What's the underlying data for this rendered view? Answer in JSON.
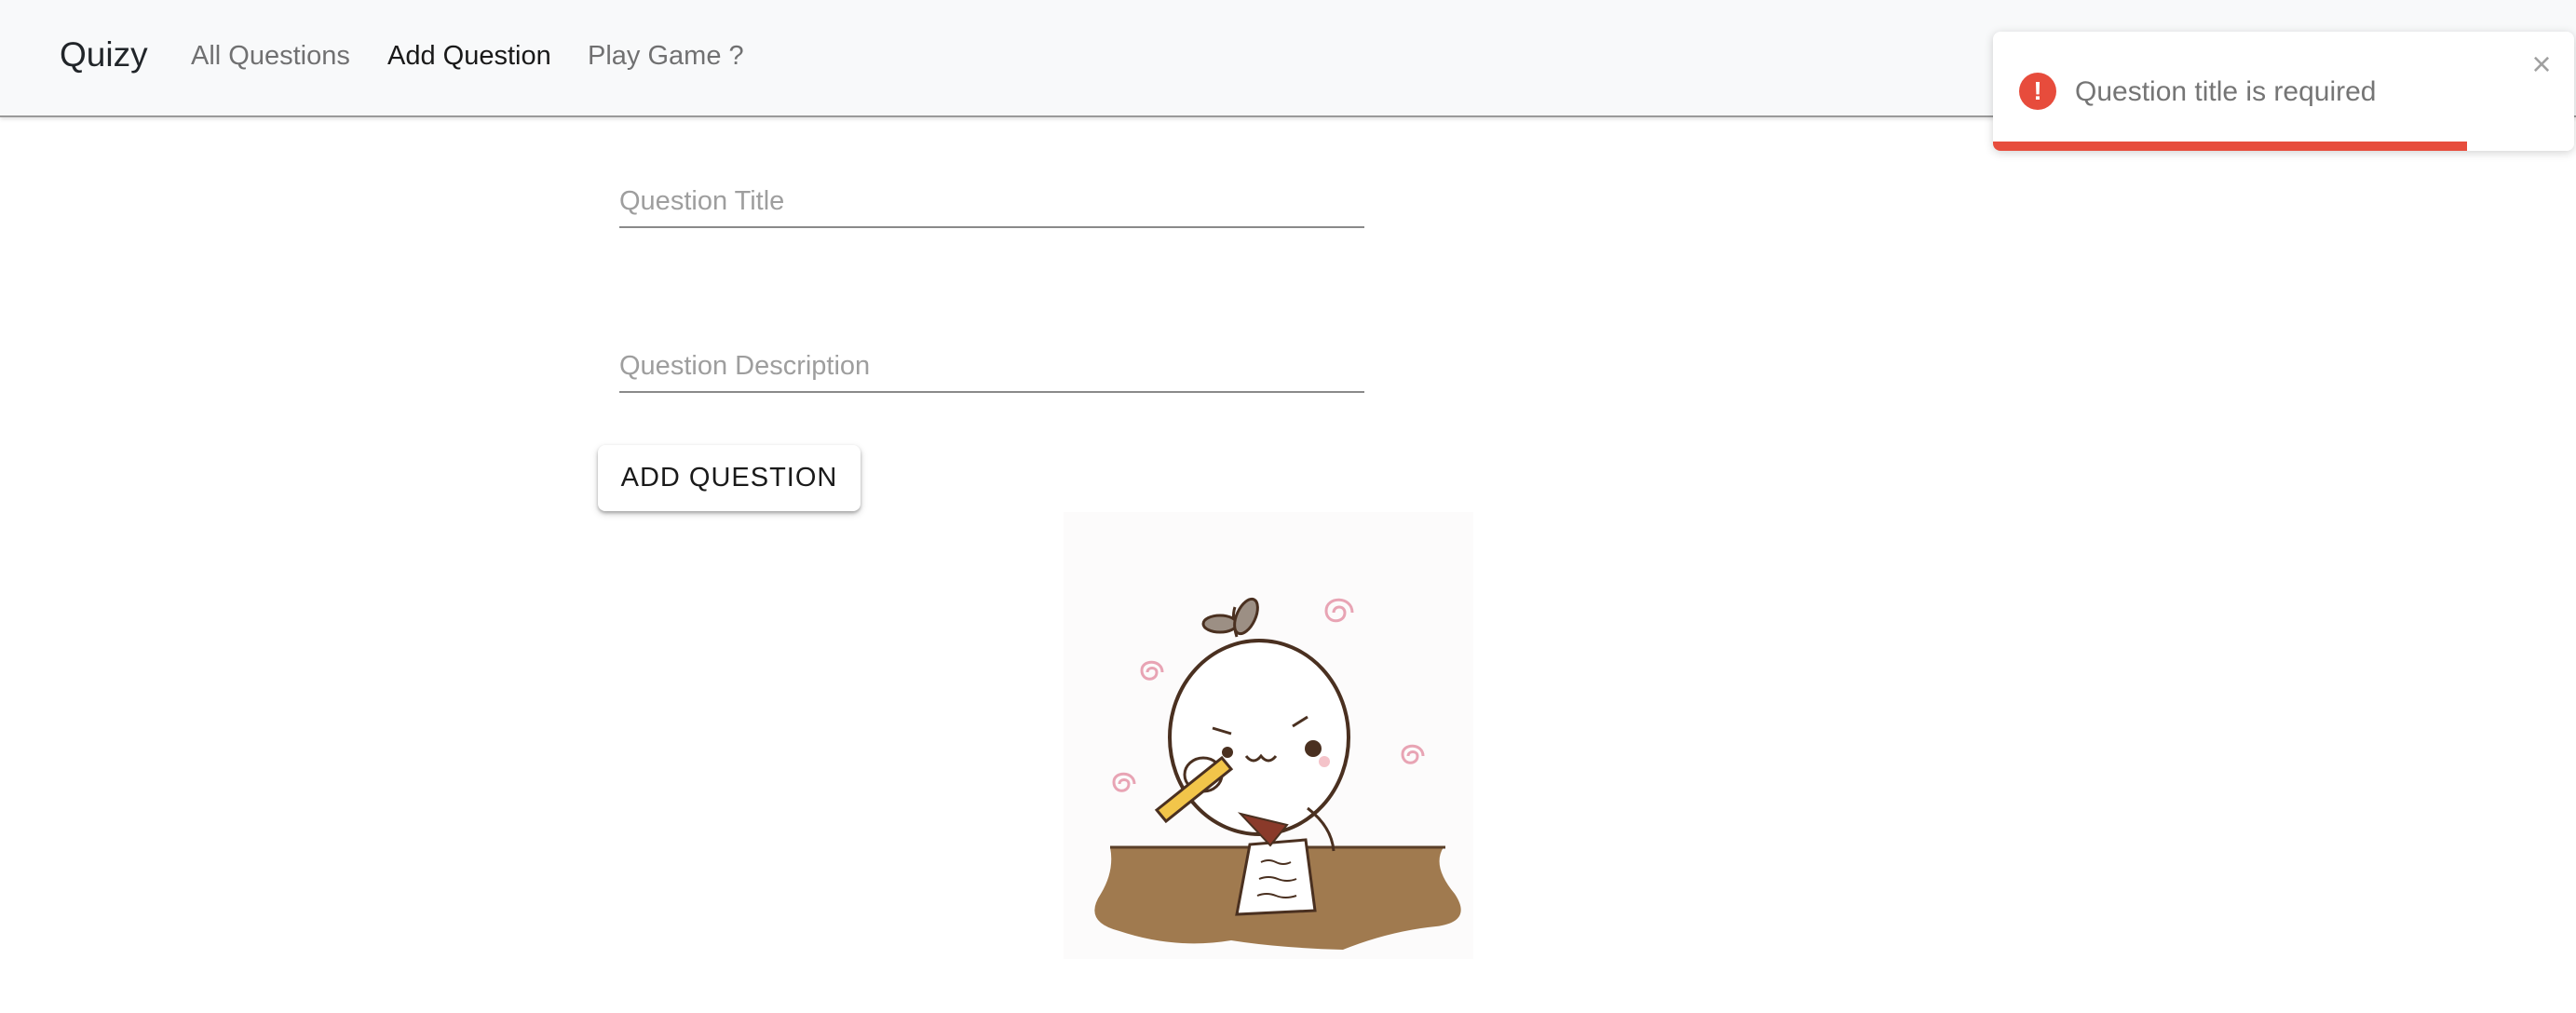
{
  "navbar": {
    "brand": "Quizy",
    "links": [
      {
        "label": "All Questions",
        "active": false
      },
      {
        "label": "Add Question",
        "active": true
      },
      {
        "label": "Play Game ?",
        "active": false
      }
    ]
  },
  "form": {
    "title_field": {
      "placeholder": "Question Title",
      "value": ""
    },
    "description_field": {
      "placeholder": "Question Description",
      "value": ""
    },
    "submit_label": "ADD QUESTION"
  },
  "toast": {
    "type": "error",
    "icon": "!",
    "message": "Question title is required",
    "close_symbol": "×",
    "progress_fraction": 0.815,
    "accent_color": "#e74c3c"
  },
  "illustration": {
    "subject": "cute character writing at desk",
    "desk_color": "#a07a4f",
    "swirl_color": "#e8a4b4"
  }
}
